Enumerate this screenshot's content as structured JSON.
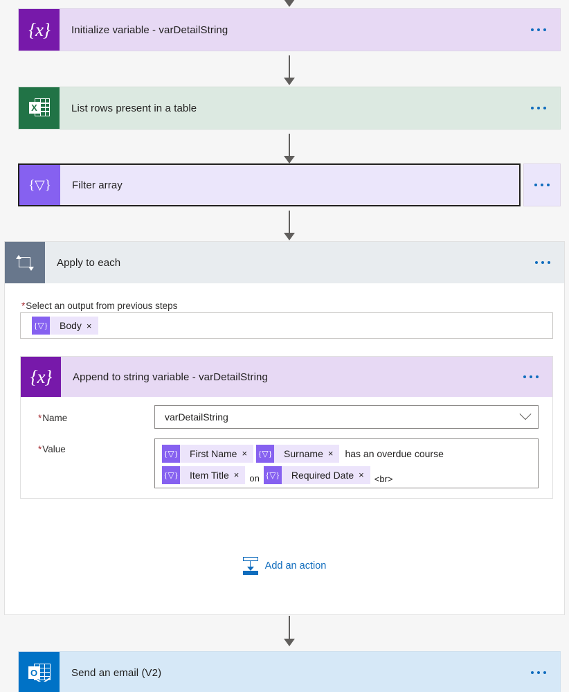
{
  "flow": {
    "steps": [
      {
        "id": "initialize-variable",
        "title": "Initialize variable - varDetailString",
        "icon": "variable-icon",
        "menu": "•••"
      },
      {
        "id": "list-rows",
        "title": "List rows present in a table",
        "icon": "excel-icon",
        "menu": "•••"
      },
      {
        "id": "filter-array",
        "title": "Filter array",
        "icon": "filter-array-icon",
        "menu": "•••",
        "selected": true
      },
      {
        "id": "send-an-email",
        "title": "Send an email (V2)",
        "icon": "outlook-icon",
        "menu": "•••"
      }
    ]
  },
  "apply_to_each": {
    "title": "Apply to each",
    "icon": "loop-icon",
    "required_marker": "*",
    "select_output_label": "Select an output from previous steps",
    "selected_token": {
      "glyph": "{▽}",
      "text": "Body",
      "remove": "×"
    },
    "append_action": {
      "title": "Append to string variable - varDetailString",
      "icon": "variable-icon",
      "name_label": "Name",
      "name_value": "varDetailString",
      "name_chevron": "chevron-down-icon",
      "value_label": "Value",
      "value_tokens_line1": [
        {
          "kind": "token",
          "glyph": "{▽}",
          "text": "First Name",
          "remove": "×"
        },
        {
          "kind": "token",
          "glyph": "{▽}",
          "text": "Surname",
          "remove": "×"
        },
        {
          "kind": "text",
          "text": "has an overdue course"
        }
      ],
      "value_tokens_line2": [
        {
          "kind": "token",
          "glyph": "{▽}",
          "text": "Item Title",
          "remove": "×"
        },
        {
          "kind": "text",
          "text": "on"
        },
        {
          "kind": "token",
          "glyph": "{▽}",
          "text": "Required Date",
          "remove": "×"
        },
        {
          "kind": "text",
          "text": "<br>"
        }
      ]
    },
    "add_action_label": "Add an action",
    "add_action_icon": "insert-below-icon"
  },
  "glyphs": {
    "variable": "{x}",
    "filter": "{▽}",
    "excel_letter": "X",
    "outlook_letter": "O"
  },
  "colors": {
    "variable_purple": "#7719aa",
    "filter_purple": "#8661f0",
    "excel_green": "#217346",
    "loop_gray": "#68778c",
    "outlook_blue": "#0072c6",
    "link_blue": "#0f6cbd",
    "required_red": "#a4262c",
    "card_variable_bg": "#e7d9f4",
    "card_excel_bg": "#dce9e1",
    "card_filter_bg": "#ebe6fb",
    "card_mail_bg": "#d6e8f7",
    "scope_header_bg": "#e8ecef",
    "page_bg": "#f6f6f6"
  }
}
